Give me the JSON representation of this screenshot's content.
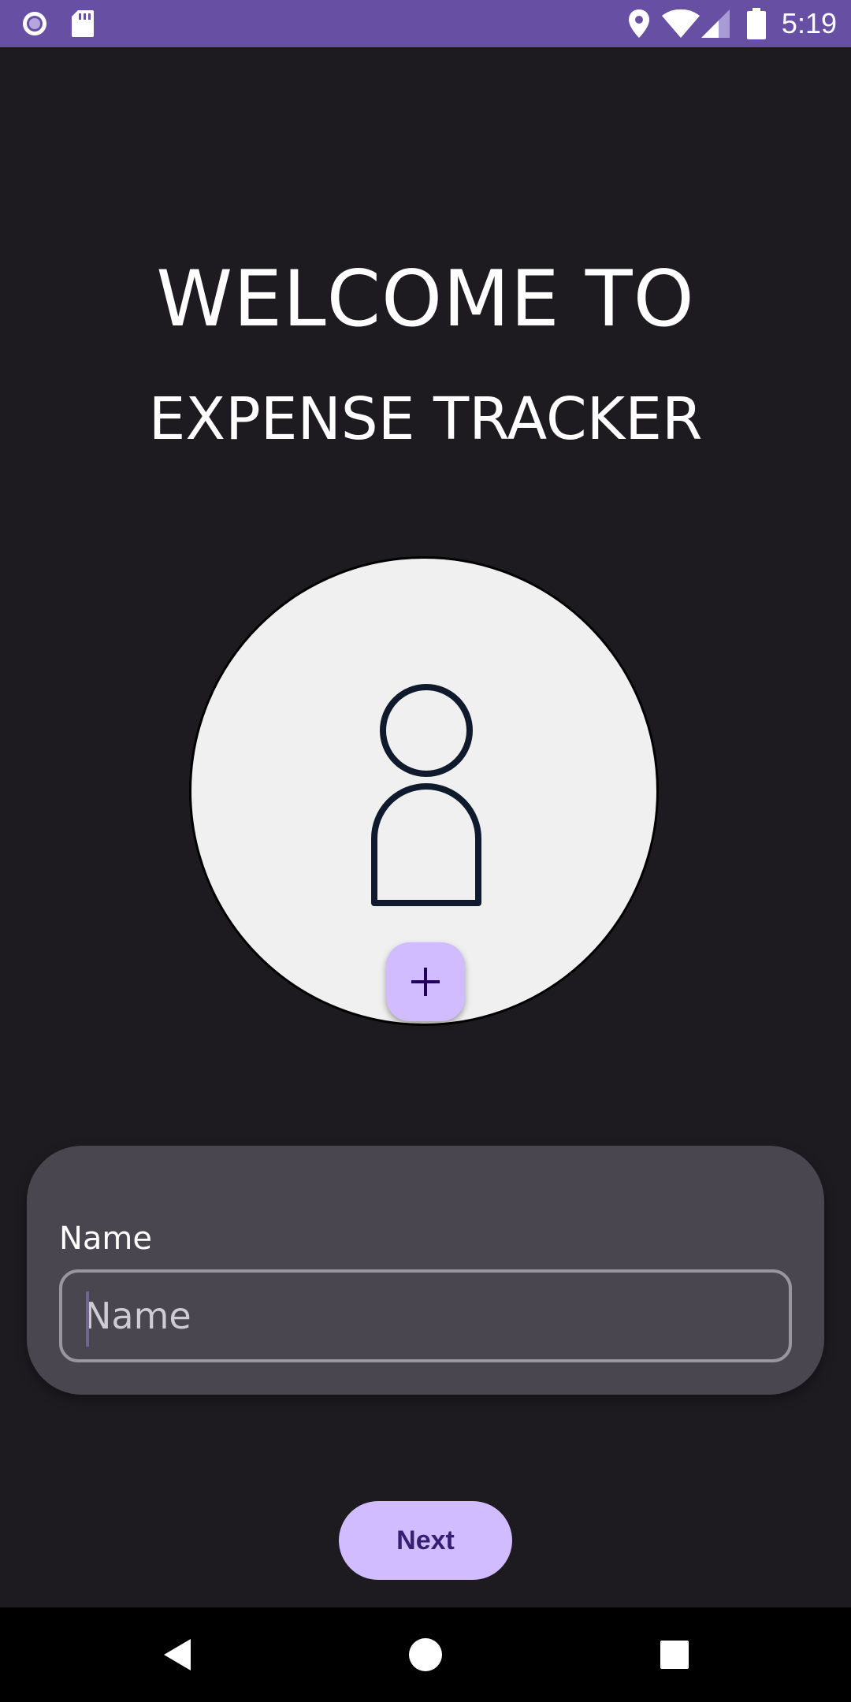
{
  "status_bar": {
    "time": "5:19",
    "icons": [
      "radio-icon",
      "sd-card-icon",
      "location-icon",
      "wifi-icon",
      "signal-icon",
      "battery-icon"
    ]
  },
  "welcome": {
    "line1": "WELCOME TO",
    "line2": "EXPENSE TRACKER"
  },
  "avatar": {
    "icon": "person-icon",
    "add_icon": "plus-icon"
  },
  "name_form": {
    "label": "Name",
    "placeholder": "Name",
    "value": ""
  },
  "next_label": "Next",
  "nav_bar": {
    "icons": [
      "back-icon",
      "home-icon",
      "recents-icon"
    ]
  },
  "colors": {
    "status_bar": "#6750a4",
    "background": "#1d1b20",
    "card": "#4a4650",
    "accent": "#d0bcff",
    "accent_text": "#381e72"
  }
}
